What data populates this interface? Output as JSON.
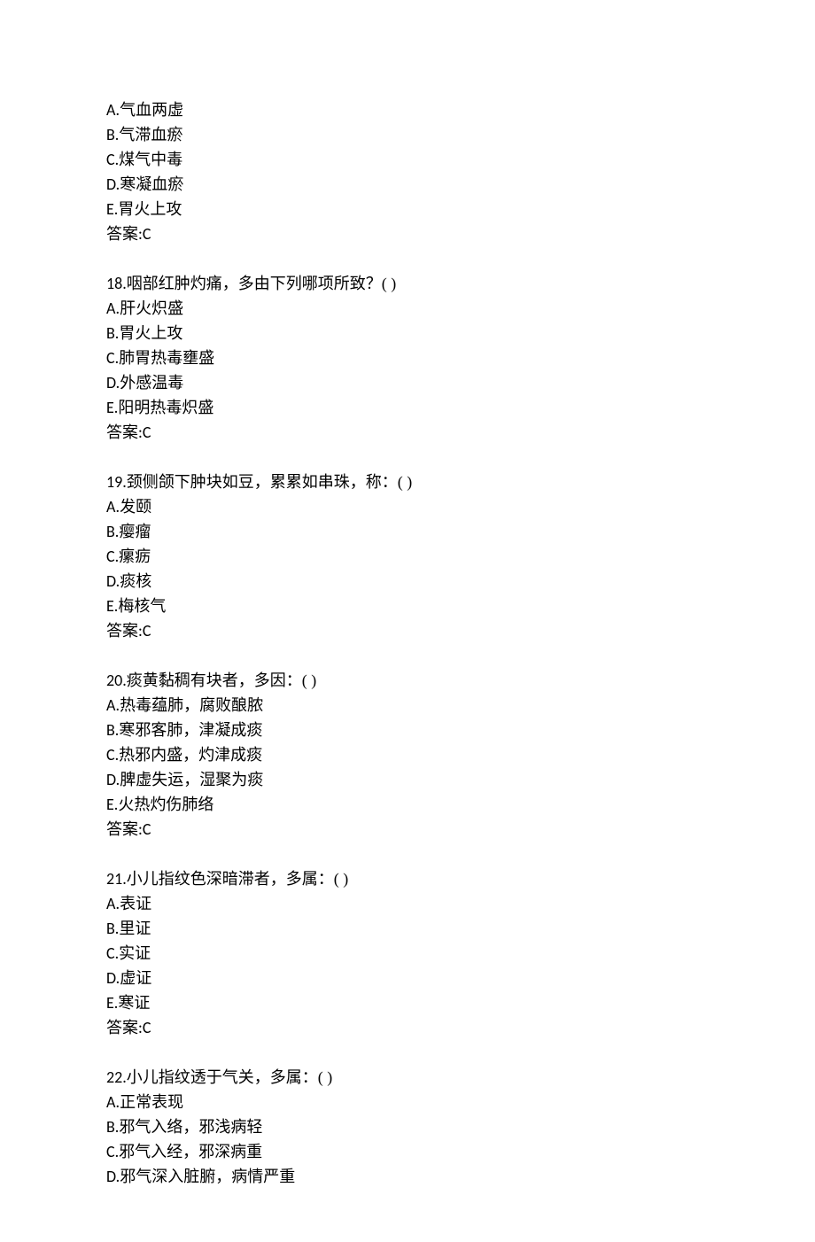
{
  "q17": {
    "options": [
      {
        "letter": "A",
        "text": "气血两虚"
      },
      {
        "letter": "B",
        "text": "气滞血瘀"
      },
      {
        "letter": "C",
        "text": "煤气中毒"
      },
      {
        "letter": "D",
        "text": "寒凝血瘀"
      },
      {
        "letter": "E",
        "text": "胃火上攻"
      }
    ],
    "answer_label": "答案",
    "answer": "C"
  },
  "q18": {
    "number": "18",
    "stem": "咽部红肿灼痛，多由下列哪项所致？( )",
    "options": [
      {
        "letter": "A",
        "text": "肝火炽盛"
      },
      {
        "letter": "B",
        "text": "胃火上攻"
      },
      {
        "letter": "C",
        "text": "肺胃热毒壅盛"
      },
      {
        "letter": "D",
        "text": "外感温毒"
      },
      {
        "letter": "E",
        "text": "阳明热毒炽盛"
      }
    ],
    "answer_label": "答案",
    "answer": "C"
  },
  "q19": {
    "number": "19",
    "stem": "颈侧颌下肿块如豆，累累如串珠，称：( )",
    "options": [
      {
        "letter": "A",
        "text": "发颐"
      },
      {
        "letter": "B",
        "text": "瘿瘤"
      },
      {
        "letter": "C",
        "text": "瘰疬"
      },
      {
        "letter": "D",
        "text": "痰核"
      },
      {
        "letter": "E",
        "text": "梅核气"
      }
    ],
    "answer_label": "答案",
    "answer": "C"
  },
  "q20": {
    "number": "20",
    "stem": "痰黄黏稠有块者，多因：( )",
    "options": [
      {
        "letter": "A",
        "text": "热毒蕴肺，腐败酿脓"
      },
      {
        "letter": "B",
        "text": "寒邪客肺，津凝成痰"
      },
      {
        "letter": "C",
        "text": "热邪内盛，灼津成痰"
      },
      {
        "letter": "D",
        "text": "脾虚失运，湿聚为痰"
      },
      {
        "letter": "E",
        "text": "火热灼伤肺络"
      }
    ],
    "answer_label": "答案",
    "answer": "C"
  },
  "q21": {
    "number": "21",
    "stem": "小儿指纹色深暗滞者，多属：( )",
    "options": [
      {
        "letter": "A",
        "text": "表证"
      },
      {
        "letter": "B",
        "text": "里证"
      },
      {
        "letter": "C",
        "text": "实证"
      },
      {
        "letter": "D",
        "text": "虚证"
      },
      {
        "letter": "E",
        "text": "寒证"
      }
    ],
    "answer_label": "答案",
    "answer": "C"
  },
  "q22": {
    "number": "22",
    "stem": "小儿指纹透于气关，多属：( )",
    "options": [
      {
        "letter": "A",
        "text": "正常表现"
      },
      {
        "letter": "B",
        "text": "邪气入络，邪浅病轻"
      },
      {
        "letter": "C",
        "text": "邪气入经，邪深病重"
      },
      {
        "letter": "D",
        "text": "邪气深入脏腑，病情严重"
      }
    ]
  }
}
